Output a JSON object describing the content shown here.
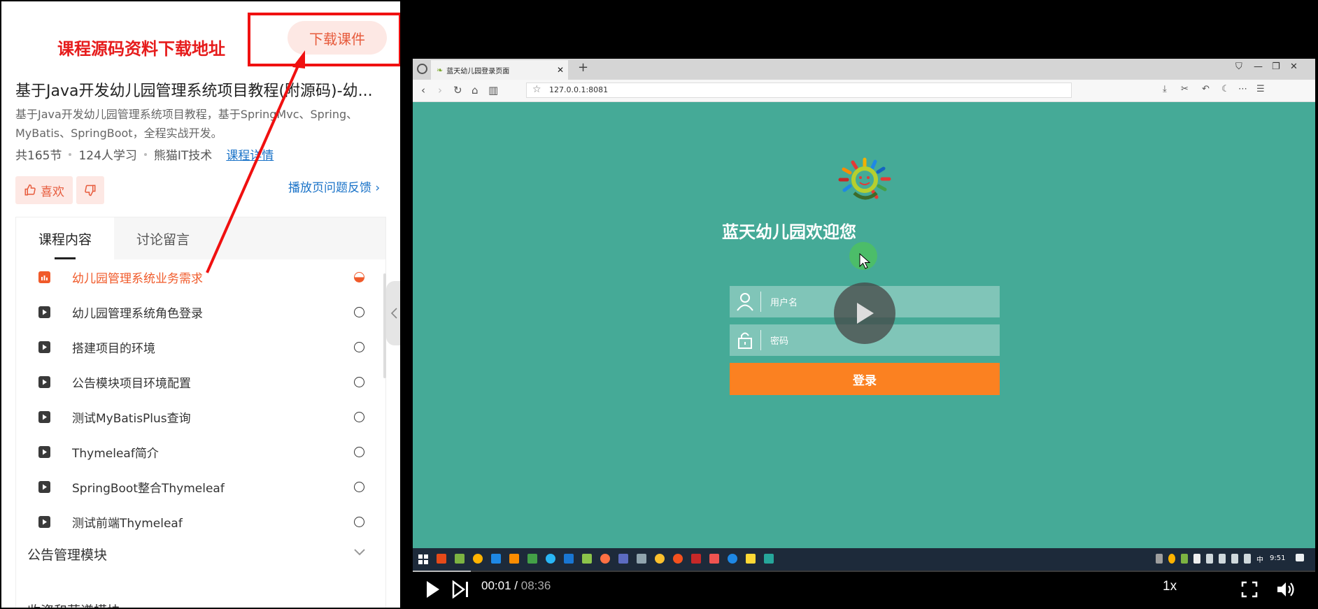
{
  "promo": {
    "text": "课程源码资料下载地址",
    "download_label": "下载课件"
  },
  "course": {
    "title": "基于Java开发幼儿园管理系统项目教程(附源码)-幼...",
    "description": "基于Java开发幼儿园管理系统项目教程，基于SpringMvc、Spring、MyBatis、SpringBoot，全程实战开发。",
    "lessons_count": "共165节",
    "learners": "124人学习",
    "author": "熊猫IT技术",
    "detail_link": "课程详情",
    "like_label": "喜欢",
    "feedback": "播放页问题反馈"
  },
  "tabs": [
    {
      "label": "课程内容"
    },
    {
      "label": "讨论留言"
    }
  ],
  "lessons": [
    {
      "title": "幼儿园管理系统业务需求",
      "active": true
    },
    {
      "title": "幼儿园管理系统角色登录"
    },
    {
      "title": "搭建项目的环境"
    },
    {
      "title": "公告模块项目环境配置"
    },
    {
      "title": "测试MyBatisPlus查询"
    },
    {
      "title": "Thymeleaf简介"
    },
    {
      "title": "SpringBoot整合Thymeleaf"
    },
    {
      "title": "测试前端Thymeleaf"
    }
  ],
  "modules": [
    {
      "title": "公告管理模块"
    },
    {
      "title": "收资和获谱模块"
    }
  ],
  "browser": {
    "tab_title": "蓝天幼儿园登录页面",
    "url": "127.0.0.1:8081"
  },
  "login_page": {
    "welcome": "蓝天幼儿园欢迎您",
    "username_placeholder": "用户名",
    "password_placeholder": "密码",
    "login_button": "登录"
  },
  "taskbar": {
    "clock": "9:51",
    "ime": "中"
  },
  "player": {
    "current_time": "00:01",
    "separator": "/",
    "total_time": "08:36",
    "rate": "1x",
    "progress": 0.064
  }
}
